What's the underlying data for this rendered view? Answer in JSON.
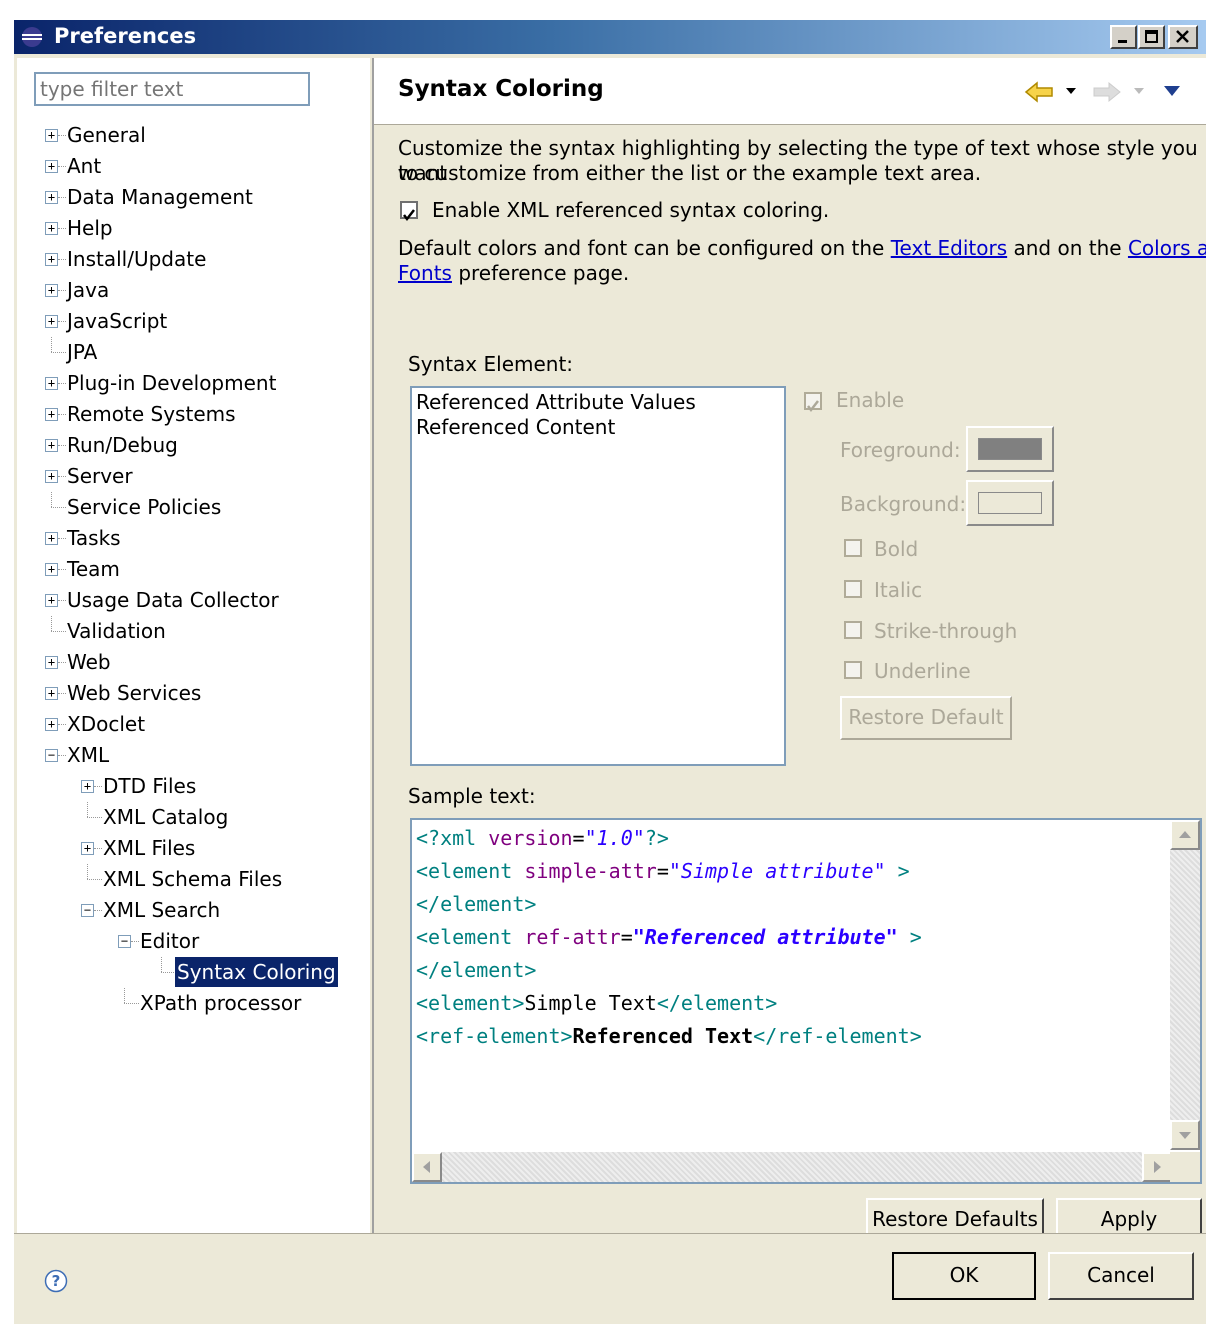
{
  "window": {
    "title": "Preferences"
  },
  "sidebar": {
    "filter_placeholder": "type filter text",
    "tree": [
      {
        "label": "General",
        "level": 0,
        "expander": "+"
      },
      {
        "label": "Ant",
        "level": 0,
        "expander": "+"
      },
      {
        "label": "Data Management",
        "level": 0,
        "expander": "+"
      },
      {
        "label": "Help",
        "level": 0,
        "expander": "+"
      },
      {
        "label": "Install/Update",
        "level": 0,
        "expander": "+"
      },
      {
        "label": "Java",
        "level": 0,
        "expander": "+"
      },
      {
        "label": "JavaScript",
        "level": 0,
        "expander": "+"
      },
      {
        "label": "JPA",
        "level": 0,
        "expander": ""
      },
      {
        "label": "Plug-in Development",
        "level": 0,
        "expander": "+"
      },
      {
        "label": "Remote Systems",
        "level": 0,
        "expander": "+"
      },
      {
        "label": "Run/Debug",
        "level": 0,
        "expander": "+"
      },
      {
        "label": "Server",
        "level": 0,
        "expander": "+"
      },
      {
        "label": "Service Policies",
        "level": 0,
        "expander": ""
      },
      {
        "label": "Tasks",
        "level": 0,
        "expander": "+"
      },
      {
        "label": "Team",
        "level": 0,
        "expander": "+"
      },
      {
        "label": "Usage Data Collector",
        "level": 0,
        "expander": "+"
      },
      {
        "label": "Validation",
        "level": 0,
        "expander": ""
      },
      {
        "label": "Web",
        "level": 0,
        "expander": "+"
      },
      {
        "label": "Web Services",
        "level": 0,
        "expander": "+"
      },
      {
        "label": "XDoclet",
        "level": 0,
        "expander": "+"
      },
      {
        "label": "XML",
        "level": 0,
        "expander": "-"
      },
      {
        "label": "DTD Files",
        "level": 1,
        "expander": "+"
      },
      {
        "label": "XML Catalog",
        "level": 1,
        "expander": ""
      },
      {
        "label": "XML Files",
        "level": 1,
        "expander": "+"
      },
      {
        "label": "XML Schema Files",
        "level": 1,
        "expander": ""
      },
      {
        "label": "XML Search",
        "level": 1,
        "expander": "-"
      },
      {
        "label": "Editor",
        "level": 2,
        "expander": "-"
      },
      {
        "label": "Syntax Coloring",
        "level": 3,
        "expander": "",
        "selected": true
      },
      {
        "label": "XPath processor",
        "level": 2,
        "expander": ""
      }
    ]
  },
  "page": {
    "title": "Syntax Coloring",
    "description_line1": "Customize the syntax highlighting by selecting the type of text whose style you want",
    "description_line2": "to customize from either the list or the example text area.",
    "enable_xml_label": "Enable XML referenced syntax coloring.",
    "enable_xml_checked": true,
    "defaults_text_a": "Default colors and font can be configured on the ",
    "link_text_editors": "Text Editors",
    "defaults_text_b": " and on the ",
    "link_colors_fonts_1": "Colors and",
    "link_colors_fonts_2": "Fonts",
    "defaults_text_c": " preference page.",
    "syntax_element_label": "Syntax Element:",
    "syntax_elements": [
      "Referenced Attribute Values",
      "Referenced Content"
    ],
    "enable_label": "Enable",
    "foreground_label": "Foreground:",
    "background_label": "Background:",
    "foreground_color": "#808080",
    "background_color": "#ece9d8",
    "bold_label": "Bold",
    "italic_label": "Italic",
    "strike_label": "Strike-through",
    "underline_label": "Underline",
    "restore_default_label": "Restore Default",
    "sample_label": "Sample text:",
    "sample": {
      "l1a": "<?xml ",
      "l1b": "version",
      "l1c": "=",
      "l1d": "\"1.0\"",
      "l1e": "?>",
      "l2a": "<element ",
      "l2b": "simple-attr",
      "l2c": "=",
      "l2d": "\"Simple attribute\"",
      "l2e": " >",
      "l3a": "</element>",
      "l4a": "<element ",
      "l4b": "ref-attr",
      "l4c": "=",
      "l4d": "\"Referenced attribute\"",
      "l4e": " >",
      "l5a": "</element>",
      "l6a": "<element>",
      "l6b": "Simple Text",
      "l6c": "</element>",
      "l7a": "<ref-element>",
      "l7b": "Referenced Text",
      "l7c": "</ref-element>"
    },
    "restore_defaults_label": "Restore Defaults",
    "apply_label": "Apply"
  },
  "footer": {
    "ok_label": "OK",
    "cancel_label": "Cancel"
  },
  "colors": {
    "title_bar": "#0a246a",
    "selection": "#0a246a",
    "tag": "#008080",
    "attribute": "#7f007f",
    "value": "#2a00ff"
  }
}
